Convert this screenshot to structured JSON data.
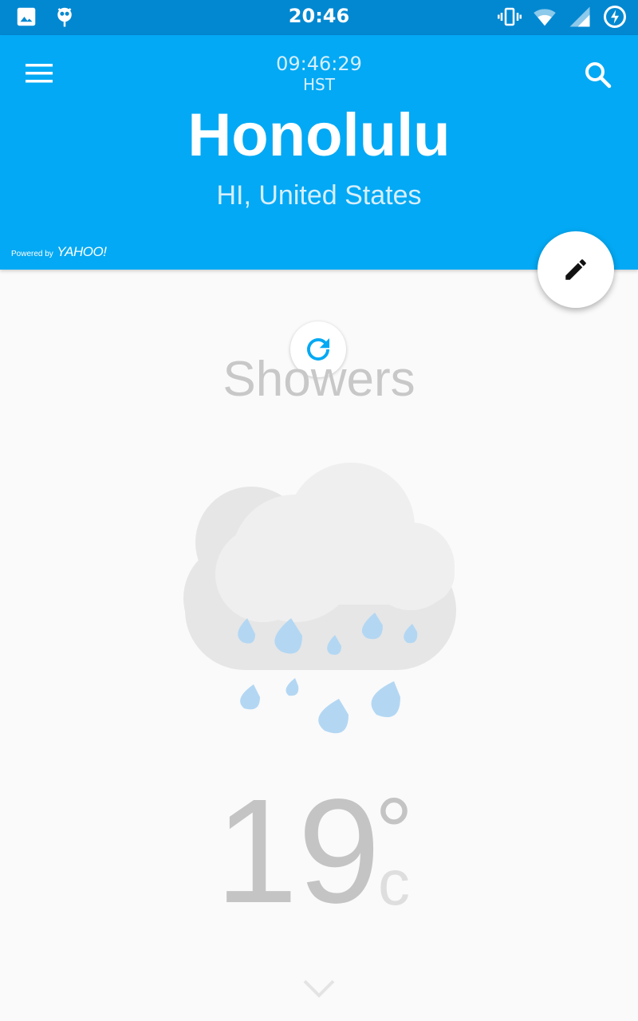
{
  "status_bar": {
    "time": "20:46",
    "left_icons": [
      "image-icon",
      "cyanogen-mascot-icon"
    ],
    "right_icons": [
      "vibrate-icon",
      "wifi-icon",
      "cell-signal-icon",
      "battery-charging-icon"
    ]
  },
  "header": {
    "menu_icon": "hamburger-menu-icon",
    "search_icon": "search-icon",
    "local_time": "09:46:29",
    "timezone": "HST",
    "city": "Honolulu",
    "region": "HI, United States",
    "powered_by_small": "Powered by",
    "powered_by_brand": "YAHOO!",
    "edit_icon": "pencil-icon",
    "bg_color": "#03a9f4"
  },
  "weather": {
    "refresh_icon": "refresh-icon",
    "condition": "Showers",
    "illustration": "rain-cloud-icon",
    "temperature": "19",
    "degree_symbol": "°",
    "unit": "c",
    "expand_icon": "chevron-down-icon"
  }
}
